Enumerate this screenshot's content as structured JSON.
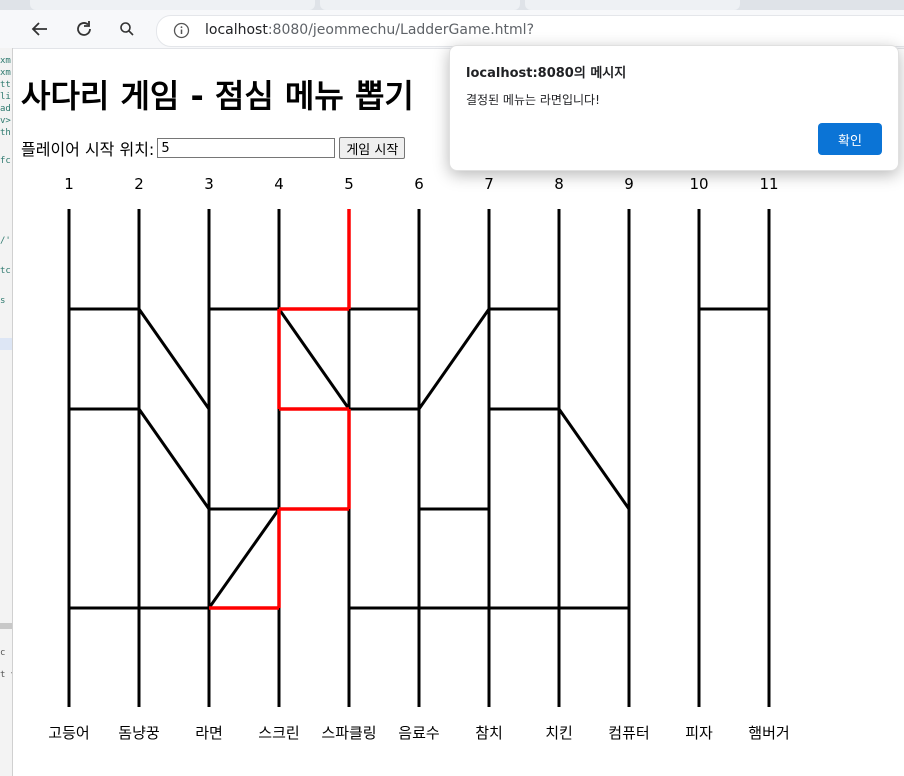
{
  "browser": {
    "url_host": "localhost",
    "url_rest": ":8080/jeommechu/LadderGame.html?"
  },
  "icons": {
    "back": "back-arrow-icon",
    "reload": "reload-icon",
    "search": "search-icon",
    "info": "info-icon"
  },
  "page": {
    "title": "사다리 게임 - 점심 메뉴 뽑기",
    "start_label": "플레이어 시작 위치:",
    "start_value": "5",
    "start_button": "게임 시작"
  },
  "ladder": {
    "columns": [
      "1",
      "2",
      "3",
      "4",
      "5",
      "6",
      "7",
      "8",
      "9",
      "10",
      "11"
    ],
    "results": [
      "고등어",
      "돔냥꿍",
      "라면",
      "스크린",
      "스파클링",
      "음료수",
      "참치",
      "치킨",
      "컴퓨터",
      "피자",
      "햄버거"
    ],
    "path_color": "#ff0000"
  },
  "dialog": {
    "title": "localhost:8080의 메시지",
    "message": "결정된 메뉴는 라면입니다!",
    "ok_button": "확인",
    "button_color": "#0b74d6"
  }
}
